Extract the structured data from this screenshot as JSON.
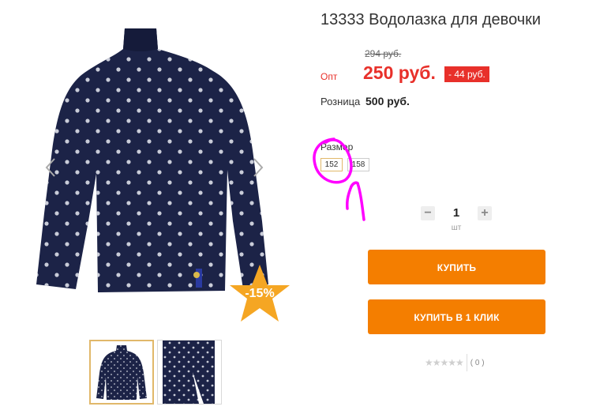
{
  "product": {
    "title": "13333 Водолазка для девочки",
    "discount_badge": "-15%",
    "old_price": "294 руб.",
    "opt_label": "Опт",
    "price": "250 руб.",
    "price_diff": "- 44 руб.",
    "retail_label": "Розница",
    "retail_price": "500 руб."
  },
  "sizes": {
    "label": "Размер",
    "options": [
      "152",
      "158"
    ],
    "selected": "152"
  },
  "quantity": {
    "minus": "−",
    "value": "1",
    "plus": "+",
    "unit": "шт"
  },
  "actions": {
    "buy": "КУПИТЬ",
    "buy_one_click": "КУПИТЬ В 1 КЛИК"
  },
  "rating": {
    "stars": "★★★★★",
    "count": "( 0 )"
  },
  "colors": {
    "accent_orange": "#f47e00",
    "price_red": "#e8302a",
    "annotation_magenta": "#ff00ff",
    "garment_navy": "#1c2347"
  },
  "icons": {
    "prev": "chevron-left-icon",
    "next": "chevron-right-icon",
    "minus": "minus-icon",
    "plus": "plus-icon",
    "star": "star-icon"
  }
}
